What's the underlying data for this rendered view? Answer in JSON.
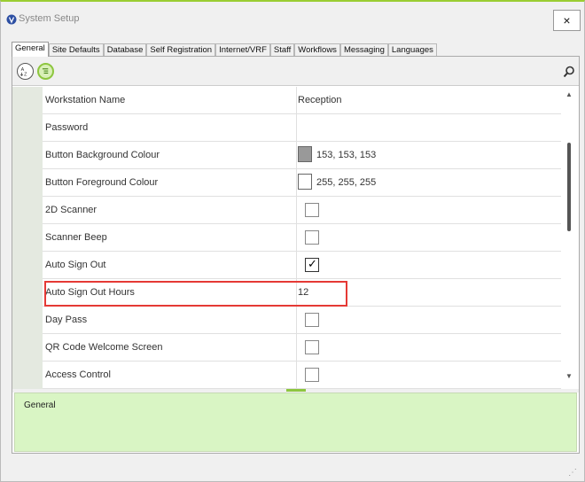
{
  "window": {
    "title": "System Setup",
    "close_symbol": "×",
    "accent_color": "#8dc63f"
  },
  "tabs": [
    {
      "label": "General",
      "active": true
    },
    {
      "label": "Site Defaults"
    },
    {
      "label": "Database"
    },
    {
      "label": "Self Registration"
    },
    {
      "label": "Internet/VRF"
    },
    {
      "label": "Staff"
    },
    {
      "label": "Workflows"
    },
    {
      "label": "Messaging"
    },
    {
      "label": "Languages"
    }
  ],
  "toolbar": {
    "sort_icon": "sort-alphabetical-icon",
    "categorized_icon": "categorized-icon",
    "search_icon": "search-icon"
  },
  "properties": [
    {
      "name": "Workstation Name",
      "value": "Reception"
    },
    {
      "name": "Password",
      "value": ""
    },
    {
      "name": "Button Background Colour",
      "value": "153, 153, 153",
      "swatch": "#999999"
    },
    {
      "name": "Button Foreground Colour",
      "value": "255, 255, 255",
      "swatch": "#ffffff"
    },
    {
      "name": "2D Scanner",
      "checkbox": false
    },
    {
      "name": "Scanner Beep",
      "checkbox": false
    },
    {
      "name": "Auto Sign Out",
      "checkbox": true
    },
    {
      "name": "Auto Sign Out Hours",
      "value": "12"
    },
    {
      "name": "Day Pass",
      "checkbox": false
    },
    {
      "name": "QR Code Welcome Screen",
      "checkbox": false
    },
    {
      "name": "Access Control",
      "checkbox": false
    }
  ],
  "highlight_color": "#e53935",
  "description": {
    "title": "General"
  }
}
